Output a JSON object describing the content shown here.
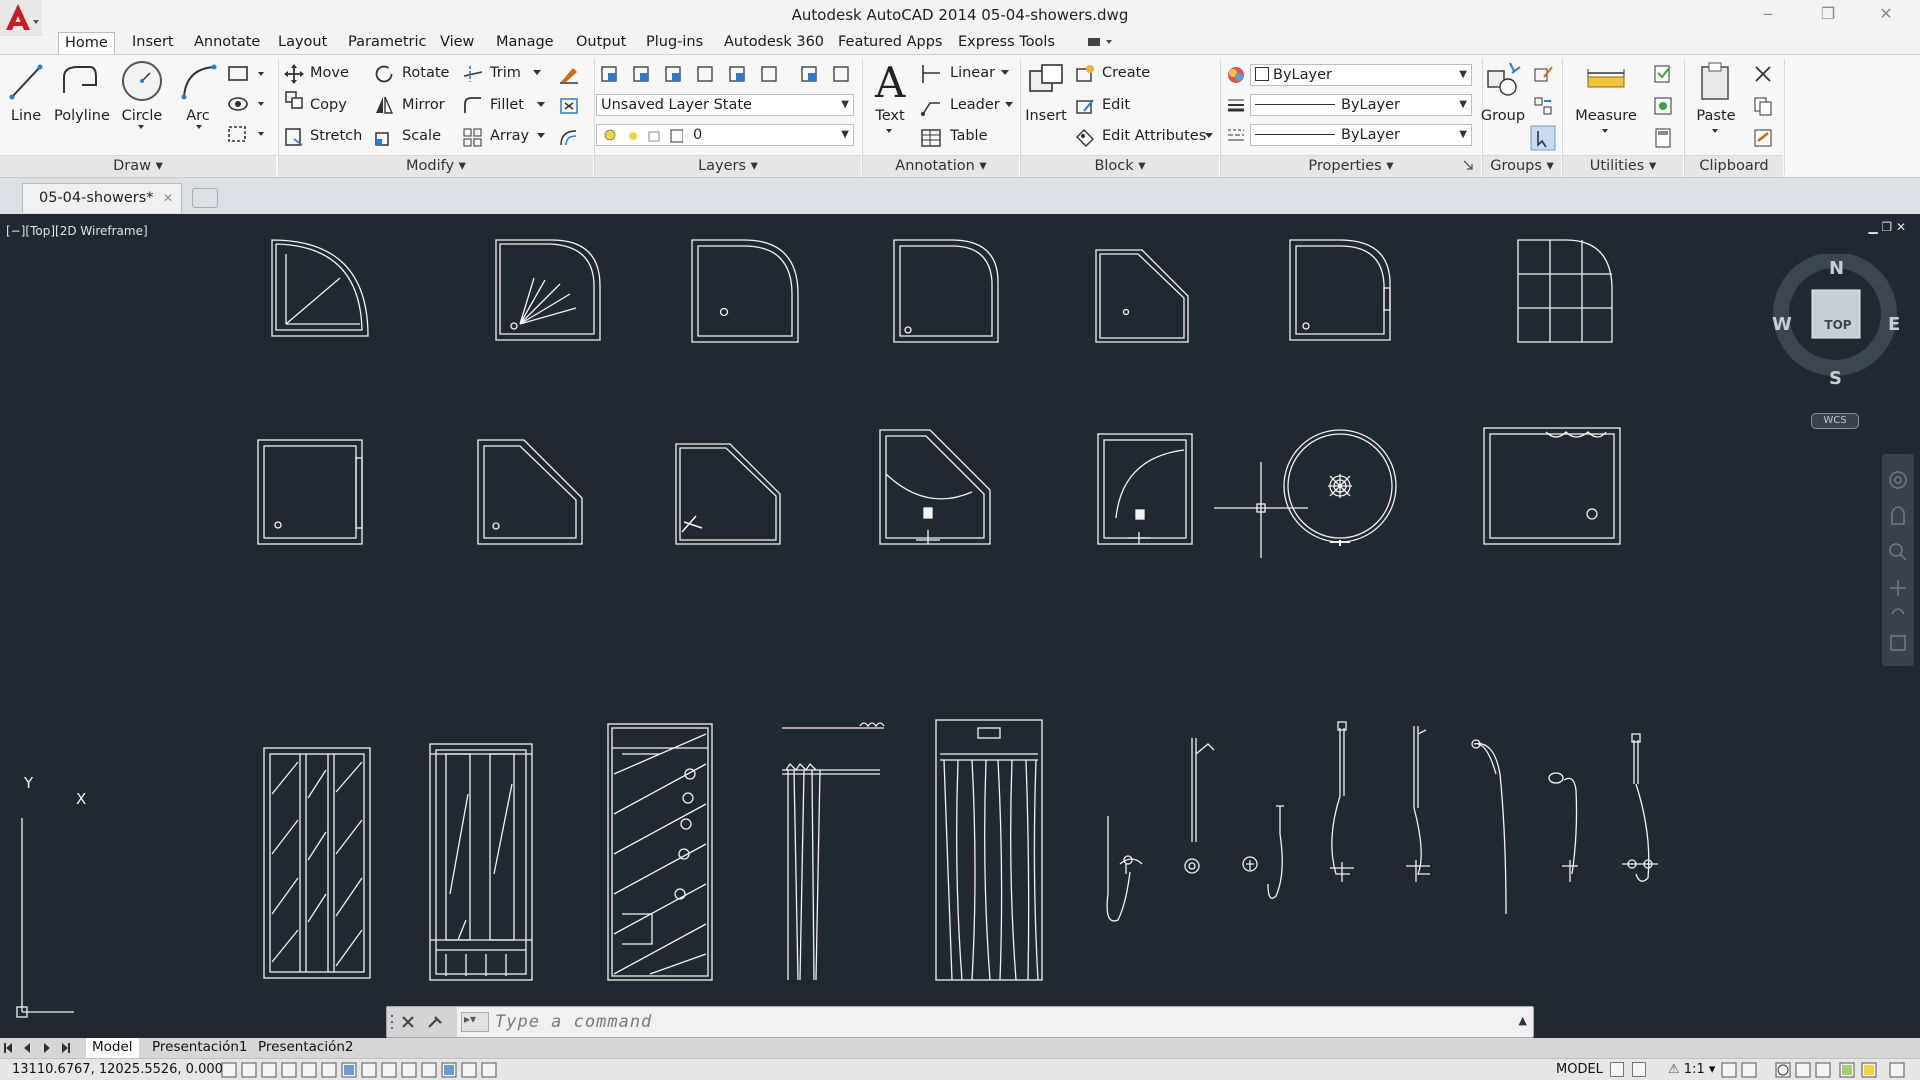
{
  "window": {
    "title": "Autodesk AutoCAD 2014    05-04-showers.dwg",
    "minimize": "‒",
    "restore": "❐",
    "close": "✕"
  },
  "menu_tabs": [
    "Home",
    "Insert",
    "Annotate",
    "Layout",
    "Parametric",
    "View",
    "Manage",
    "Output",
    "Plug-ins",
    "Autodesk 360",
    "Featured Apps",
    "Express Tools"
  ],
  "active_menu_tab": "Home",
  "ribbon": {
    "draw": {
      "line": "Line",
      "polyline": "Polyline",
      "circle": "Circle",
      "arc": "Arc",
      "panel": "Draw"
    },
    "modify": {
      "move": "Move",
      "rotate": "Rotate",
      "trim": "Trim",
      "copy": "Copy",
      "mirror": "Mirror",
      "fillet": "Fillet",
      "stretch": "Stretch",
      "scale": "Scale",
      "array": "Array",
      "panel": "Modify"
    },
    "layers": {
      "layer_state": "Unsaved Layer State",
      "current_layer": "0",
      "panel": "Layers"
    },
    "annotation": {
      "text": "Text",
      "linear": "Linear",
      "leader": "Leader",
      "table": "Table",
      "panel": "Annotation"
    },
    "block": {
      "insert": "Insert",
      "create": "Create",
      "edit": "Edit",
      "edit_attributes": "Edit Attributes",
      "panel": "Block"
    },
    "properties": {
      "color": "ByLayer",
      "linetype": "ByLayer",
      "lineweight": "ByLayer",
      "panel": "Properties"
    },
    "groups": {
      "group": "Group",
      "panel": "Groups"
    },
    "utilities": {
      "measure": "Measure",
      "panel": "Utilities"
    },
    "clipboard": {
      "paste": "Paste",
      "panel": "Clipboard"
    }
  },
  "document_tab": {
    "name": "05-04-showers*",
    "close": "✕"
  },
  "viewport": {
    "label": "[−][Top][2D Wireframe]",
    "controls": "▁ ❐ ✕"
  },
  "viewcube": {
    "north": "N",
    "south": "S",
    "east": "E",
    "west": "W",
    "face": "TOP",
    "wcs": "WCS"
  },
  "ucs": {
    "x": "X",
    "y": "Y"
  },
  "command_line": {
    "placeholder": "Type  a  command"
  },
  "layout_tabs": [
    "Model",
    "Presentación1",
    "Presentación2"
  ],
  "status": {
    "coordinates": "13110.6767, 12025.5526, 0.0000",
    "space": "MODEL",
    "annotation_scale": "1:1"
  },
  "colors": {
    "canvas": "#212830",
    "linework": "#ffffff",
    "ribbon": "#f7f7f7",
    "accent_red": "#c81d25"
  }
}
